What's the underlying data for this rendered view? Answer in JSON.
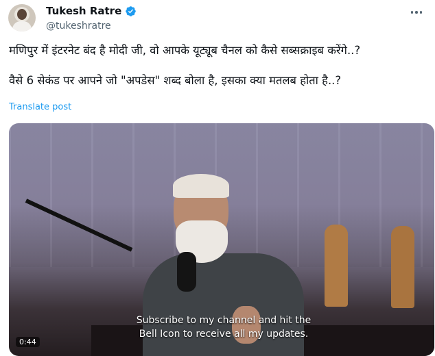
{
  "author": {
    "display_name": "Tukesh Ratre",
    "handle": "@tukeshratre",
    "verified_color": "#1d9bf0"
  },
  "post": {
    "text_line1": "मणिपुर में इंटरनेट बंद है मोदी जी, वो आपके यूट्यूब चैनल को कैसे सब्सक्राइब करेंगे..?",
    "text_line2": "वैसे 6 सेकंड पर आपने जो \"अपडेस\" शब्द बोला है, इसका क्या मतलब होता है..?",
    "translate_label": "Translate post"
  },
  "media": {
    "subtitle_line1": "Subscribe to my channel and hit the",
    "subtitle_line2": "Bell Icon to receive all my updates.",
    "timestamp": "0:44"
  },
  "icons": {
    "more": "more-options-icon",
    "verified": "verified-badge-icon"
  }
}
